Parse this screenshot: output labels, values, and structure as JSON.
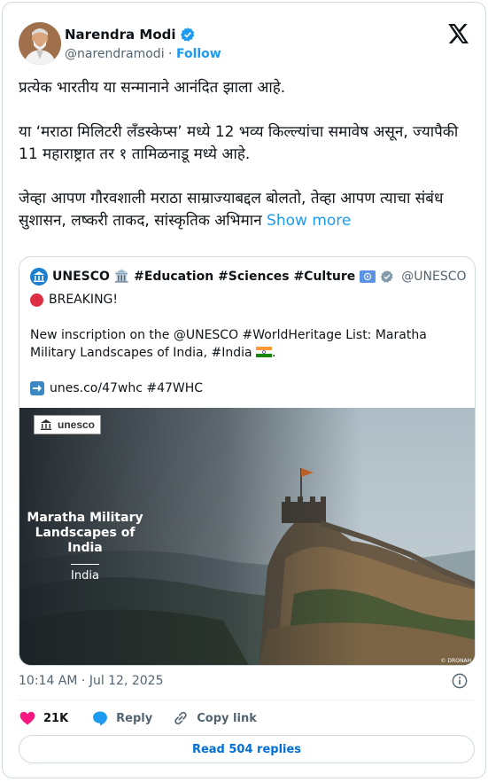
{
  "author": {
    "name": "Narendra Modi",
    "handle": "@narendramodi",
    "separator": "·",
    "follow_label": "Follow"
  },
  "tweet": {
    "text": "प्रत्येक भारतीय या सन्मानाने आनंदित झाला आहे.\n\nया ‘मराठा मिलिटरी लँडस्केप्स’ मध्ये 12 भव्य किल्ल्यांचा समावेष असून, ज्यापैकी 11 महाराष्ट्रात तर १ तामिळनाडू मध्ये आहे.\n\nजेव्हा आपण गौरवशाली मराठा साम्राज्याबद्दल बोलतो, तेव्हा आपण त्याचा संबंध सुशासन, लष्करी ताकद, सांस्कृतिक अभिमान",
    "show_more_label": "Show more"
  },
  "quote": {
    "author_name": "UNESCO 🏛️ #Education #Sciences #Culture",
    "handle": "@UNESCO",
    "breaking": "BREAKING!",
    "body": "New inscription on the @UNESCO #WorldHeritage List: Maratha Military Landscapes of India, #India",
    "link_line": "unes.co/47whc #47WHC",
    "image": {
      "logo_text": "unesco",
      "title": "Maratha Military Landscapes of India",
      "subtitle": "India",
      "credit": "© DRONAH"
    }
  },
  "meta": {
    "time": "10:14 AM",
    "separator": "·",
    "date": "Jul 12, 2025"
  },
  "actions": {
    "likes": "21K",
    "reply_label": "Reply",
    "copy_link_label": "Copy link",
    "read_replies_label": "Read 504 replies"
  },
  "colors": {
    "link": "#1d9bf0",
    "like": "#f91880",
    "verified": "#1d9bf0",
    "un_flag": "#5b92e5"
  },
  "icons": [
    "verified-badge-icon",
    "x-logo-icon",
    "museum-icon",
    "un-flag-icon",
    "red-circle-icon",
    "india-flag-icon",
    "right-arrow-icon",
    "info-icon",
    "heart-icon",
    "reply-icon",
    "link-icon"
  ]
}
